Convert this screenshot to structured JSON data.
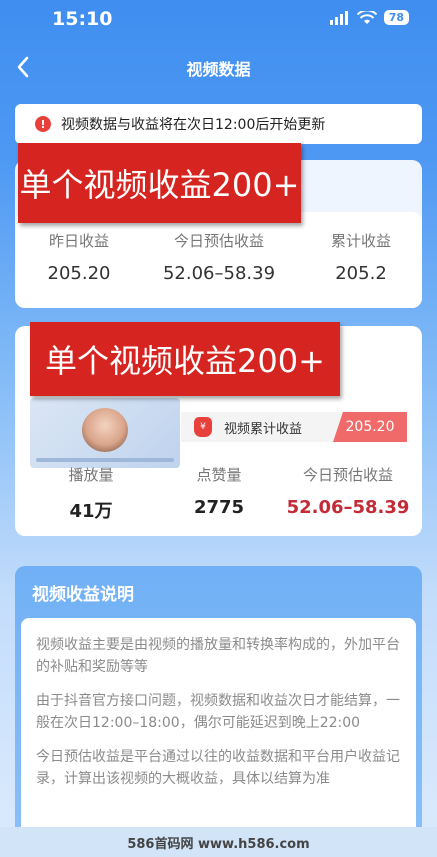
{
  "status_bar": {
    "time": "15:10",
    "battery": "78"
  },
  "nav": {
    "title": "视频数据"
  },
  "notice": {
    "text": "视频数据与收益将在次日12:00后开始更新"
  },
  "overlay": {
    "banner_text": "单个视频收益200+"
  },
  "summary": {
    "stats": [
      {
        "label": "昨日收益",
        "value": "205.20"
      },
      {
        "label": "今日预估收益",
        "value": "52.06–58.39"
      },
      {
        "label": "累计收益",
        "value": "205.2"
      }
    ]
  },
  "video": {
    "cumulative_label": "视频累计收益",
    "cumulative_value": "205.20",
    "stats": [
      {
        "label": "播放量",
        "value": "41万"
      },
      {
        "label": "点赞量",
        "value": "2775"
      },
      {
        "label": "今日预估收益",
        "value": "52.06–58.39"
      }
    ]
  },
  "explain": {
    "title": "视频收益说明",
    "paragraphs": [
      "视频收益主要是由视频的播放量和转换率构成的，外加平台的补贴和奖励等等",
      "由于抖音官方接口问题，视频数据和收益次日才能结算，一般在次日12:00–18:00，偶尔可能延迟到晚上22:00",
      "今日预估收益是平台通过以往的收益数据和平台用户收益记录，计算出该视频的大概收益，具体以结算为准"
    ]
  },
  "watermark": {
    "text": "586首码网 www.h586.com"
  },
  "colors": {
    "accent_blue": "#3f8ef0",
    "red": "#d62420",
    "value_red": "#c32b36"
  },
  "icons": {
    "back": "chevron-left-icon",
    "notice": "alert-circle-icon",
    "bag": "money-bag-icon"
  }
}
